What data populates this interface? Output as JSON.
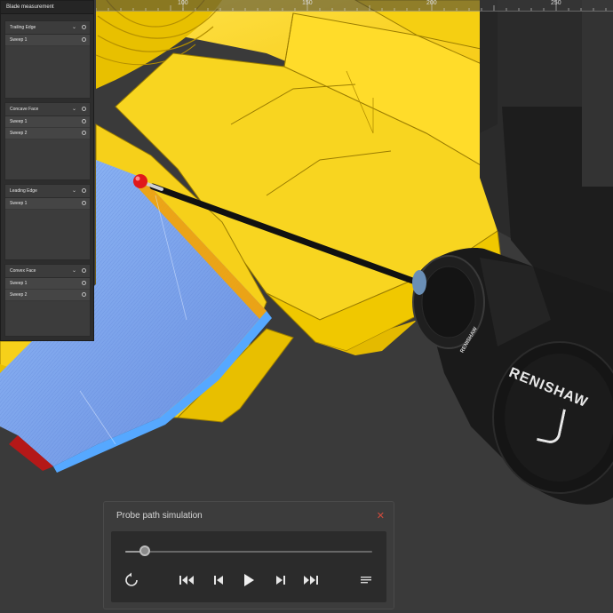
{
  "blade_panel": {
    "title": "Blade measurement",
    "groups": [
      {
        "label": "Trailing Edge",
        "chevron": "⌄",
        "sweeps": [
          "Sweep 1"
        ]
      },
      {
        "label": "Concave Face",
        "chevron": "⌄",
        "sweeps": [
          "Sweep 1",
          "Sweep 2"
        ]
      },
      {
        "label": "Leading Edge",
        "chevron": "⌄",
        "sweeps": [
          "Sweep 1"
        ]
      },
      {
        "label": "Convex Face",
        "chevron": "⌄",
        "sweeps": [
          "Sweep 1",
          "Sweep 2"
        ]
      }
    ]
  },
  "ruler": {
    "labels": [
      "100",
      "150",
      "200",
      "250"
    ]
  },
  "probe_head": {
    "brand": "RENISHAW"
  },
  "simulation": {
    "title": "Probe path simulation",
    "close_glyph": "✕",
    "progress": 0.08,
    "controls": [
      "restart-icon",
      "skip-to-start-icon",
      "step-back-icon",
      "play-icon",
      "step-forward-icon",
      "skip-to-end-icon",
      "list-icon"
    ]
  },
  "colors": {
    "blade_yellow": "#f6d21c",
    "blade_blue": "#7aa6ee",
    "probe_tip_red": "#e0181a",
    "background": "#3a3a3a",
    "panel": "#2d2d2d",
    "accent_close": "#d24b3c"
  }
}
